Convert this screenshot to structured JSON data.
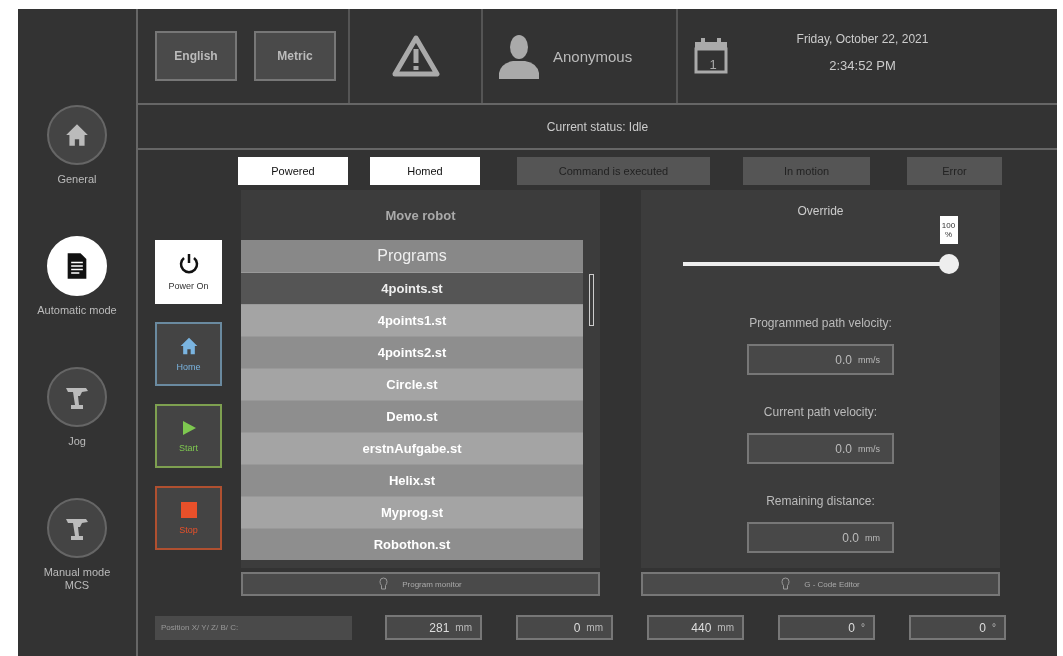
{
  "header": {
    "language_button": "English",
    "units_button": "Metric",
    "user": "Anonymous",
    "date": "Friday, October 22, 2021",
    "time": "2:34:52 PM",
    "calendar_day": "1"
  },
  "sidebar": {
    "items": [
      {
        "label": "General",
        "kind": "home",
        "selected": false
      },
      {
        "label": "Automatic mode",
        "kind": "document",
        "selected": true
      },
      {
        "label": "Jog",
        "kind": "robot",
        "selected": false
      },
      {
        "label": "Manual mode MCS",
        "kind": "robot",
        "selected": false
      }
    ]
  },
  "status": "Current status: Idle",
  "indicators": [
    {
      "label": "Powered",
      "on": true
    },
    {
      "label": "Homed",
      "on": true
    },
    {
      "label": "Command is executed",
      "on": false
    },
    {
      "label": "In motion",
      "on": false
    },
    {
      "label": "Error",
      "on": false
    }
  ],
  "controls": [
    {
      "label": "Power On",
      "kind": "power"
    },
    {
      "label": "Home",
      "kind": "home"
    },
    {
      "label": "Start",
      "kind": "start"
    },
    {
      "label": "Stop",
      "kind": "stop"
    }
  ],
  "program_panel": {
    "title": "Move robot",
    "list_title": "Programs",
    "items": [
      {
        "name": "4points.st",
        "selected": true
      },
      {
        "name": "4points1.st",
        "selected": false
      },
      {
        "name": "4points2.st",
        "selected": false
      },
      {
        "name": "Circle.st",
        "selected": false
      },
      {
        "name": "Demo.st",
        "selected": false
      },
      {
        "name": "erstnAufgabe.st",
        "selected": false
      },
      {
        "name": "Helix.st",
        "selected": false
      },
      {
        "name": "Myprog.st",
        "selected": false
      },
      {
        "name": "Robothon.st",
        "selected": false
      }
    ],
    "button": "Program monitor"
  },
  "override_panel": {
    "title": "Override",
    "slider": {
      "level": 1.0,
      "value": "100",
      "unit": "%"
    },
    "readouts": [
      {
        "label": "Programmed path velocity:",
        "value": "0.0",
        "unit": "mm/s"
      },
      {
        "label": "Current path velocity:",
        "value": "0.0",
        "unit": "mm/s"
      },
      {
        "label": "Remaining distance:",
        "value": "0.0",
        "unit": "mm"
      }
    ],
    "button": "G - Code Editor"
  },
  "position": {
    "label": "Position X/ Y/ Z/ B/ C:",
    "fields": [
      {
        "value": "281",
        "unit": "mm"
      },
      {
        "value": "0",
        "unit": "mm"
      },
      {
        "value": "440",
        "unit": "mm"
      },
      {
        "value": "0",
        "unit": "°"
      },
      {
        "value": "0",
        "unit": "°"
      }
    ]
  }
}
